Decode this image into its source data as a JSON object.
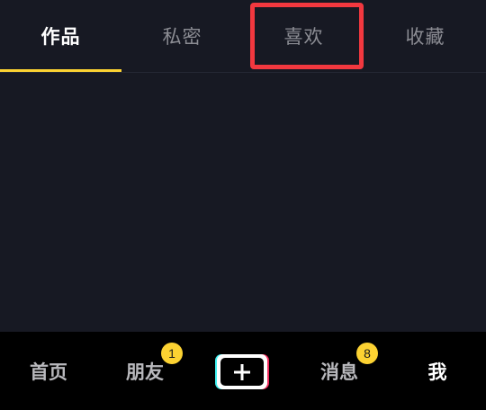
{
  "tabs": [
    {
      "label": "作品",
      "active": true
    },
    {
      "label": "私密",
      "active": false
    },
    {
      "label": "喜欢",
      "active": false
    },
    {
      "label": "收藏",
      "active": false
    }
  ],
  "bottom_nav": {
    "home": "首页",
    "friends": "朋友",
    "friends_badge": "1",
    "create_icon": "plus-icon",
    "messages": "消息",
    "messages_badge": "8",
    "me": "我"
  },
  "colors": {
    "accent": "#fcd232",
    "highlight": "#f2383f",
    "background": "#171923"
  }
}
